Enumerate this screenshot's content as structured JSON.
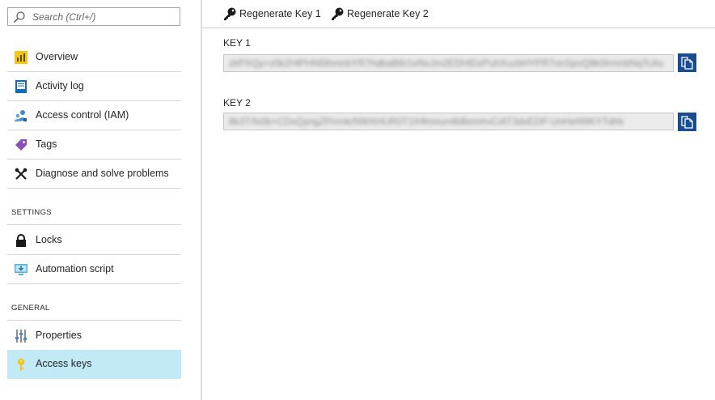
{
  "search": {
    "placeholder": "Search (Ctrl+/)",
    "value": ""
  },
  "menu": {
    "top_items": [
      {
        "label": "Overview",
        "icon": "overview-icon"
      },
      {
        "label": "Activity log",
        "icon": "activity-log-icon"
      },
      {
        "label": "Access control (IAM)",
        "icon": "iam-icon"
      },
      {
        "label": "Tags",
        "icon": "tag-icon"
      },
      {
        "label": "Diagnose and solve problems",
        "icon": "wrench-icon"
      }
    ],
    "settings": {
      "title": "SETTINGS",
      "items": [
        {
          "label": "Locks",
          "icon": "lock-icon"
        },
        {
          "label": "Automation script",
          "icon": "automation-script-icon"
        }
      ]
    },
    "general": {
      "title": "GENERAL",
      "items": [
        {
          "label": "Properties",
          "icon": "properties-icon"
        },
        {
          "label": "Access keys",
          "icon": "key-icon",
          "selected": true
        }
      ]
    }
  },
  "toolbar": {
    "regen1_label": "Regenerate Key 1",
    "regen2_label": "Regenerate Key 2"
  },
  "keys": [
    {
      "label": "KEY 1",
      "value": "zkPXQy+z0k2HlPHN5lhmnbYR7hdbaB6r1eNsJm2EDHlDzPuhXuzbHYPR7onSpvQ9k0IrmnbNqTcAs"
    },
    {
      "label": "KEY 2",
      "value": "8k3T/fx0b+CDsQyngZPmnkrNWXHUR0T1IHfmnun4bBemhvCiAT3dvEDP-UnHef49KYTdhk"
    }
  ],
  "colors": {
    "selected_bg": "#c2e9f6",
    "copy_button": "#1a4d8f",
    "key_field_bg": "#ebebeb"
  }
}
